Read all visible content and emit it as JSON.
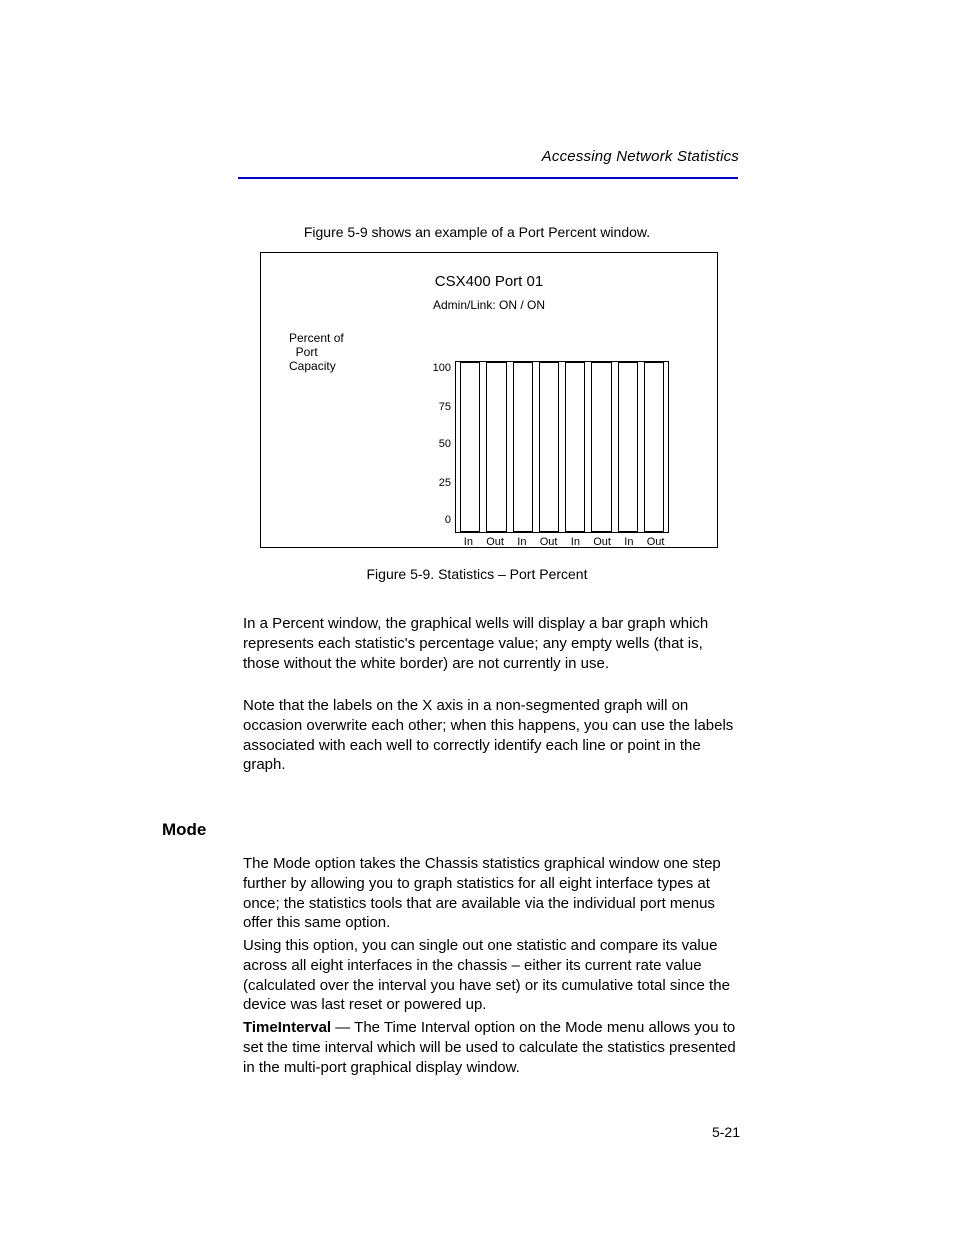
{
  "running_head": "Accessing Network Statistics",
  "figure_label_top": "Figure 5-9 shows an example of a Port Percent window.",
  "figure": {
    "title": "CSX400 Port 01",
    "status": "Admin/Link:  ON / ON",
    "axis_label": "Percent of\n  Port\nCapacity",
    "y_ticks": [
      "100",
      "75",
      "50",
      "25",
      "0"
    ],
    "x_ticks": [
      "In",
      "Out",
      "In",
      "Out",
      "In",
      "Out",
      "In",
      "Out"
    ]
  },
  "figure_caption": "Figure 5-9. Statistics – Port Percent",
  "para1": "In a Percent window, the graphical wells will display a bar graph which represents each statistic's percentage value; any empty wells (that is, those without the white border) are not currently in use.",
  "para2": "Note that the labels on the X axis in a non-segmented graph will on occasion overwrite each other; when this happens, you can use the labels associated with each well to correctly identify each line or point in the graph.",
  "heading_mode": "Mode",
  "para3": "The Mode option takes the Chassis statistics graphical window one step further by allowing you to graph statistics for all eight interface types at once; the statistics tools that are available via the individual port menus offer this same option.",
  "para4": "Using this option, you can single out one statistic and compare its value across all eight interfaces in the chassis – either its current rate value (calculated over the interval you have set) or its cumulative total since the device was last reset or powered up.",
  "para5_label": "TimeInterval",
  "para5_text": " — The Time Interval option on the Mode menu allows you to set the time interval which will be used to calculate the statistics presented in the multi-port graphical display window.",
  "page_number": "5-21",
  "chart_data": {
    "type": "bar",
    "title": "CSX400 Port 01",
    "subtitle": "Admin/Link: ON / ON",
    "ylabel": "Percent of Port Capacity",
    "ylim": [
      0,
      100
    ],
    "categories": [
      "In",
      "Out",
      "In",
      "Out",
      "In",
      "Out",
      "In",
      "Out"
    ],
    "values": [
      100,
      100,
      100,
      100,
      100,
      100,
      100,
      100
    ]
  }
}
